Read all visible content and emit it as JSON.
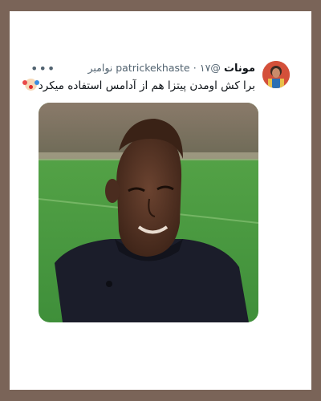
{
  "tweet": {
    "display_name": "مونات",
    "handle": "@patrickekhaste",
    "separator": "·",
    "date": "۱۷ نوامبر",
    "text": "برا کش اومدن پیتزا هم از آدامس استفاده میکرد",
    "more_icon": "more-horizontal-icon",
    "emoji": "clown-face-emoji"
  },
  "colors": {
    "frame": "#7a6458",
    "card": "#ffffff",
    "text_primary": "#0f1419",
    "text_secondary": "#536471"
  }
}
